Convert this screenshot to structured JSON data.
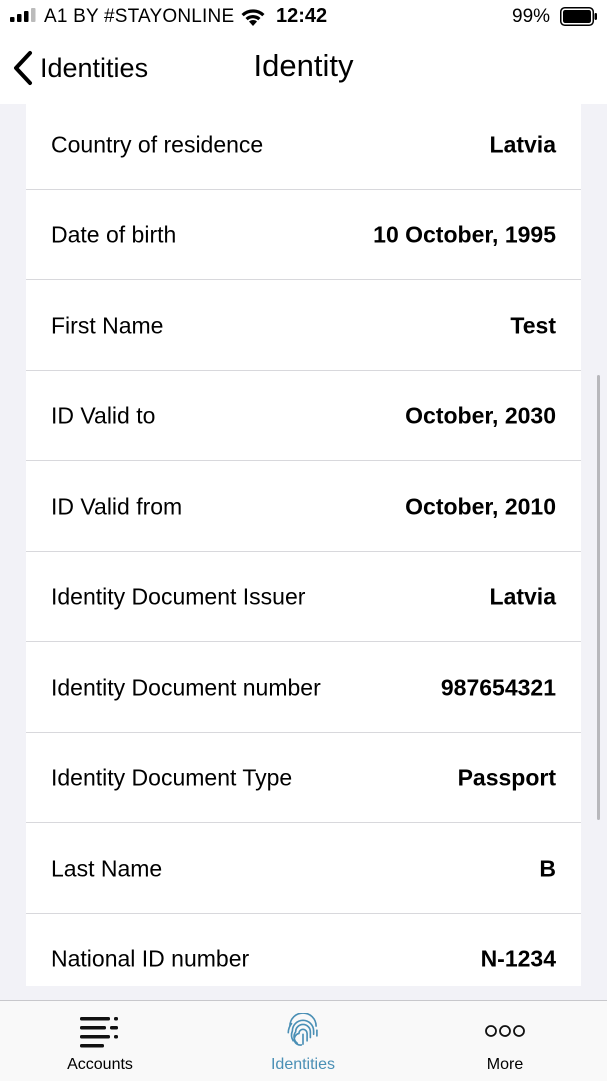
{
  "status_bar": {
    "carrier": "A1 BY #STAYONLINE",
    "time": "12:42",
    "battery_percent": "99%"
  },
  "nav": {
    "back_label": "Identities",
    "title": "Identity"
  },
  "rows": [
    {
      "label": "Country of residence",
      "value": "Latvia"
    },
    {
      "label": "Date of birth",
      "value": "10 October, 1995"
    },
    {
      "label": "First Name",
      "value": "Test"
    },
    {
      "label": "ID Valid to",
      "value": "October, 2030"
    },
    {
      "label": "ID Valid from",
      "value": "October, 2010"
    },
    {
      "label": "Identity Document Issuer",
      "value": "Latvia"
    },
    {
      "label": "Identity Document number",
      "value": "987654321"
    },
    {
      "label": "Identity Document Type",
      "value": "Passport"
    },
    {
      "label": "Last Name",
      "value": "B"
    },
    {
      "label": "National ID number",
      "value": "N-1234"
    }
  ],
  "tabs": [
    {
      "label": "Accounts",
      "icon": "menu-list-icon",
      "active": false
    },
    {
      "label": "Identities",
      "icon": "fingerprint-icon",
      "active": true
    },
    {
      "label": "More",
      "icon": "more-dots-icon",
      "active": false
    }
  ],
  "colors": {
    "accent": "#4a8fb5",
    "background": "#f2f2f7",
    "separator": "#d8d8dc"
  }
}
